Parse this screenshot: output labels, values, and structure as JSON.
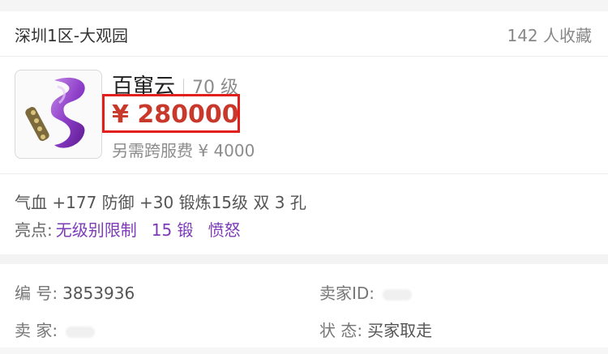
{
  "header": {
    "server": "深圳1区-大观园",
    "favorites": "142 人收藏"
  },
  "item": {
    "icon": "purple-ribbon-weapon-icon",
    "name": "百窜云",
    "level": "70 级",
    "price": "¥ 280000",
    "extra_fee": "另需跨服费 ¥ 4000"
  },
  "attributes": "气血 +177 防御 +30 锻炼15级 双 3 孔",
  "highlights": {
    "label": "亮点:",
    "tags": [
      "无级别限制",
      "15 锻",
      "愤怒"
    ]
  },
  "meta": {
    "id_label": "编 号:",
    "id_value": "3853936",
    "seller_id_label": "卖家ID:",
    "seller_label": "卖 家:",
    "status_label": "状 态:",
    "status_value": "买家取走"
  },
  "colors": {
    "price": "#c8382b",
    "price_highlight_box": "#e1201d",
    "tag": "#7d3bb8"
  }
}
